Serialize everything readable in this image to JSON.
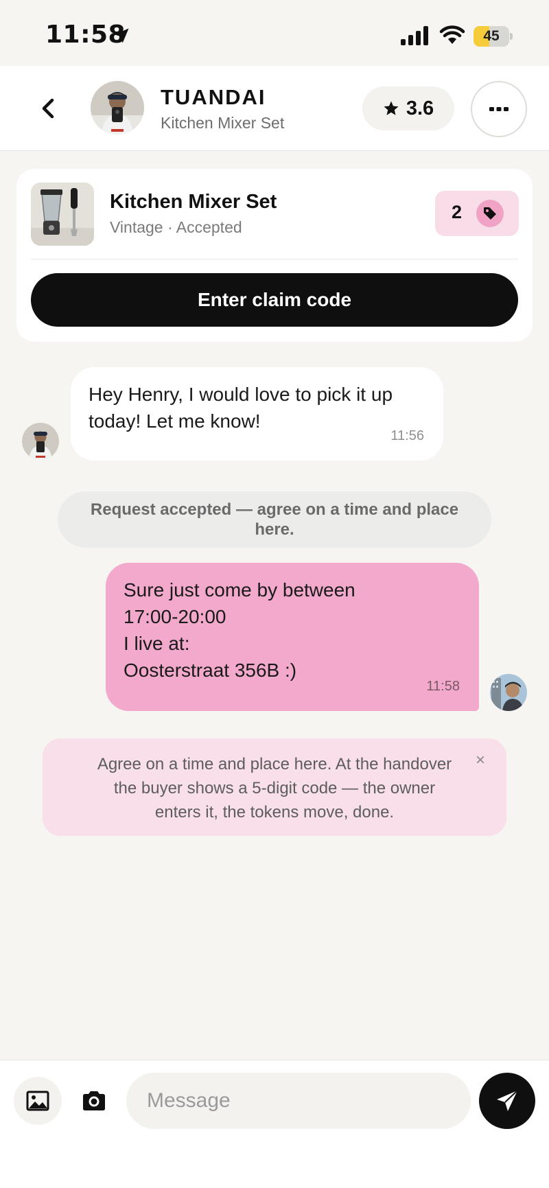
{
  "status_bar": {
    "time": "11:58",
    "battery_level": 45,
    "battery_label": "45",
    "icons": [
      "location-arrow-icon",
      "signal-icon",
      "wifi-icon",
      "battery-icon"
    ]
  },
  "header": {
    "back_icon": "chevron-left-icon",
    "user_name": "TUANDAI",
    "subtitle": "Kitchen Mixer Set",
    "rating": "3.6",
    "rating_icon": "star-icon",
    "more_icon": "more-horizontal-icon"
  },
  "item_card": {
    "title": "Kitchen Mixer Set",
    "subtitle": "Vintage · Accepted",
    "token_count": "2",
    "token_icon": "tag-icon",
    "claim_button_label": "Enter claim code"
  },
  "messages": [
    {
      "direction": "incoming",
      "lines": [
        "Hey Henry, I would love to pick it up",
        "today! Let me know!"
      ],
      "time": "11:56"
    },
    {
      "direction": "outgoing",
      "lines": [
        "Sure just come by between",
        "17:00-20:00",
        "I live at:",
        "Oosterstraat 356B :)"
      ],
      "time": "11:58"
    }
  ],
  "system_message": {
    "lines": [
      "Request accepted — agree on a time and place",
      "here."
    ]
  },
  "info_card": {
    "lines": [
      "Agree on a time and place here. At the handover",
      "the buyer shows a 5-digit code — the owner",
      "enters it, the tokens move, done."
    ],
    "close_label": "×"
  },
  "composer": {
    "placeholder": "Message",
    "value": "",
    "icons": [
      "image-icon",
      "camera-icon",
      "send-icon"
    ]
  },
  "colors": {
    "background": "#f6f5f1",
    "outgoing_bubble": "#f2a9cb",
    "info_card": "#f8dfe9",
    "token_pill": "#f8dde8",
    "primary_button": "#0f0f0f",
    "battery_fill": "#f6cc3b"
  }
}
